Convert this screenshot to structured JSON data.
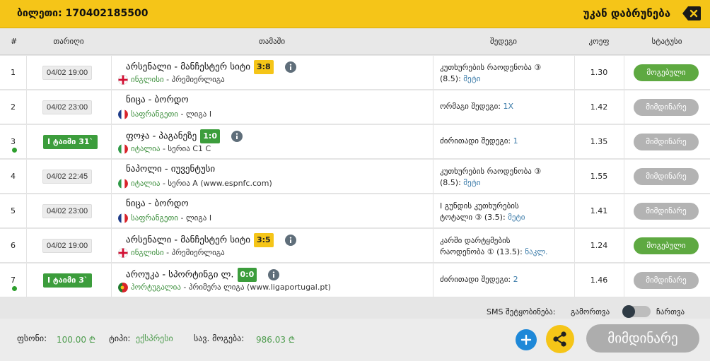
{
  "header": {
    "ticket_label": "ბილეთი: 170402185500",
    "back_label": "უკან დაბრუნება"
  },
  "columns": {
    "num": "#",
    "date": "თარიღი",
    "match": "თამაში",
    "bet": "შედეგი",
    "odds": "კოეფ",
    "status": "სტატუსი"
  },
  "rows": [
    {
      "num": "1",
      "date": "04/02 19:00",
      "live": false,
      "match": "არსენალი - მანჩესტერ სიტი",
      "score": "3:8",
      "score_style": "yellow",
      "info": true,
      "flag": "england",
      "country": "ინგლისი",
      "league": " - პრემიერლიგა",
      "bet_lines": [
        "კუთხურების რაოდენობა ③",
        "(8.5): "
      ],
      "bet_value": "მეტი",
      "odds": "1.30",
      "status": "მოგებული",
      "status_type": "won"
    },
    {
      "num": "2",
      "date": "04/02 23:00",
      "live": false,
      "match": "ნიცა - ბორდო",
      "score": "",
      "score_style": "",
      "info": false,
      "flag": "france",
      "country": "საფრანგეთი",
      "league": " - ლიგა I",
      "bet_lines": [
        "ორმაგი შედეგი: "
      ],
      "bet_value": "1X",
      "odds": "1.42",
      "status": "მიმდინარე",
      "status_type": "pending"
    },
    {
      "num": "3",
      "date": "I ტაიმი 31`",
      "live": true,
      "match": "ფოჯა - პაგანეზე",
      "score": "1:0",
      "score_style": "green",
      "info": true,
      "flag": "italy",
      "country": "იტალია",
      "league": " - სერია C1 C",
      "bet_lines": [
        "ძირითადი შედეგი: "
      ],
      "bet_value": "1",
      "odds": "1.35",
      "status": "მიმდინარე",
      "status_type": "pending"
    },
    {
      "num": "4",
      "date": "04/02 22:45",
      "live": false,
      "match": "ნაპოლი - იუვენტუსი",
      "score": "",
      "score_style": "",
      "info": false,
      "flag": "italy",
      "country": "იტალია",
      "league": " - სერია A (www.espnfc.com)",
      "bet_lines": [
        "კუთხურების რაოდენობა ③",
        "(8.5): "
      ],
      "bet_value": "მეტი",
      "odds": "1.55",
      "status": "მიმდინარე",
      "status_type": "pending"
    },
    {
      "num": "5",
      "date": "04/02 23:00",
      "live": false,
      "match": "ნიცა - ბორდო",
      "score": "",
      "score_style": "",
      "info": false,
      "flag": "france",
      "country": "საფრანგეთი",
      "league": " - ლიგა I",
      "bet_lines": [
        "I გუნდის კუთხურების",
        "ტოტალი ③ (3.5): "
      ],
      "bet_value": "მეტი",
      "odds": "1.41",
      "status": "მიმდინარე",
      "status_type": "pending"
    },
    {
      "num": "6",
      "date": "04/02 19:00",
      "live": false,
      "match": "არსენალი - მანჩესტერ სიტი",
      "score": "3:5",
      "score_style": "yellow",
      "info": true,
      "flag": "england",
      "country": "ინგლისი",
      "league": " - პრემიერლიგა",
      "bet_lines": [
        "კარში დარტყმების",
        "რაოდენობა ① (13.5): "
      ],
      "bet_value": "ნაკლ.",
      "odds": "1.24",
      "status": "მოგებული",
      "status_type": "won"
    },
    {
      "num": "7",
      "date": "I ტაიმი 3`",
      "live": true,
      "match": "აროუკა - სპორტინგი ლ.",
      "score": "0:0",
      "score_style": "green",
      "info": true,
      "flag": "portugal",
      "country": "პორტუგალია",
      "league": " - პრიმერა ლიგა (www.ligaportugal.pt)",
      "bet_lines": [
        "ძირითადი შედეგი: "
      ],
      "bet_value": "2",
      "odds": "1.46",
      "status": "მიმდინარე",
      "status_type": "pending"
    }
  ],
  "sms": {
    "label": "SMS შეტყობინება:",
    "off_label": "გამორთვა",
    "on_label": "ჩართვა"
  },
  "footer": {
    "stake_label": "ფსონი:",
    "stake_value": "100.00 ₾",
    "type_label": "ტიპი:",
    "type_value": "ექსპრესი",
    "win_label": "სავ. მოგება:",
    "win_value": "986.03 ₾",
    "status_label": "მიმდინარე"
  },
  "colors": {
    "accent": "#f5c518",
    "won": "#5ea941",
    "pending": "#b3b3b3",
    "live": "#3c9d3c",
    "link": "#3a7aa8"
  }
}
